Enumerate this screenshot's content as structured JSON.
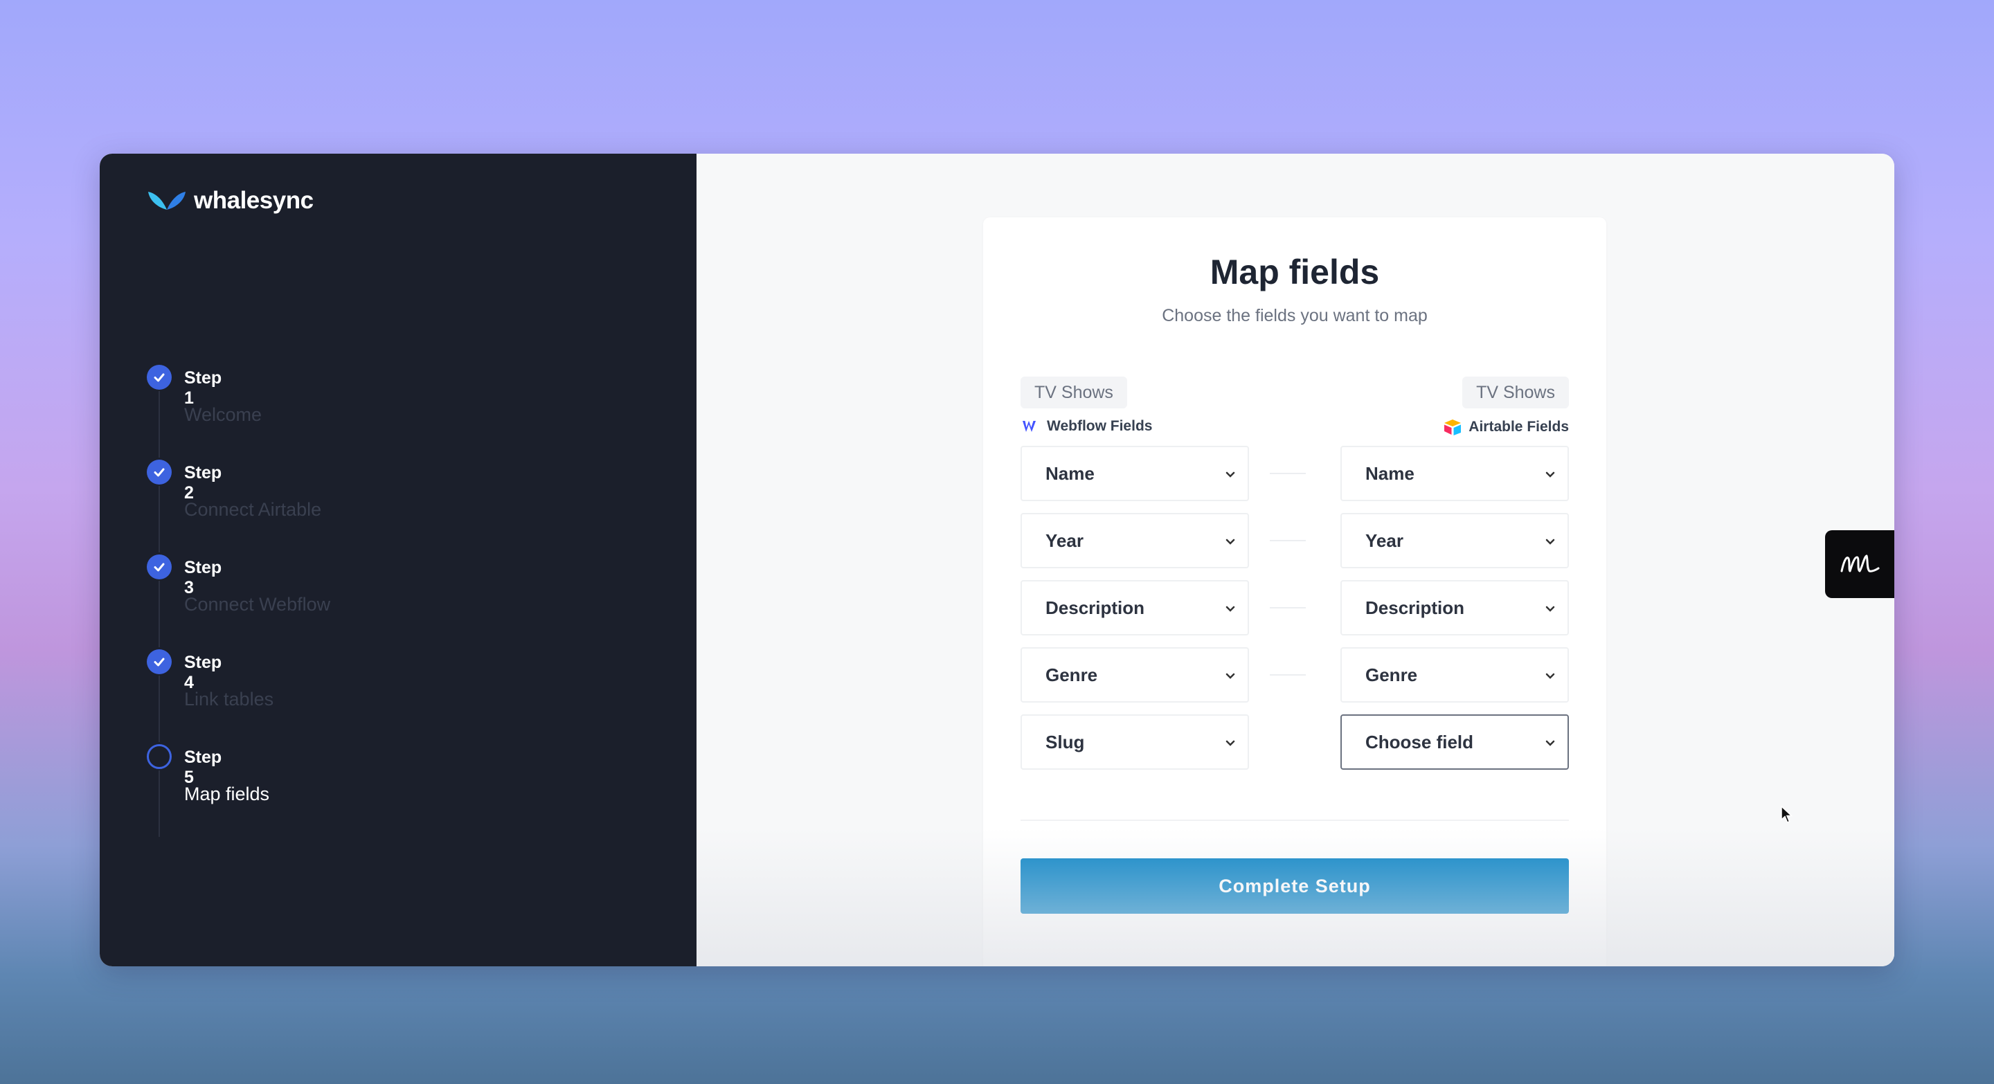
{
  "app": {
    "logo_text": "whalesync",
    "accent_color": "#3d63e0",
    "button_color": "#0a84c6"
  },
  "steps": [
    {
      "title": "Step 1",
      "subtitle": "Welcome",
      "status": "complete"
    },
    {
      "title": "Step 2",
      "subtitle": "Connect Airtable",
      "status": "complete"
    },
    {
      "title": "Step 3",
      "subtitle": "Connect Webflow",
      "status": "complete"
    },
    {
      "title": "Step 4",
      "subtitle": "Link tables",
      "status": "complete"
    },
    {
      "title": "Step 5",
      "subtitle": "Map fields",
      "status": "current"
    }
  ],
  "card": {
    "title": "Map fields",
    "subtitle": "Choose the fields you want to map",
    "left_table": "TV Shows",
    "right_table": "TV Shows",
    "left_label": "Webflow Fields",
    "right_label": "Airtable Fields",
    "left_fields": [
      "Name",
      "Year",
      "Description",
      "Genre",
      "Slug"
    ],
    "right_fields": [
      "Name",
      "Year",
      "Description",
      "Genre",
      "Choose field"
    ],
    "button_label": "Complete Setup"
  },
  "icons": {
    "logo": "whale-tail-icon",
    "step_complete": "check-circle-icon",
    "step_current": "circle-outline-icon",
    "webflow": "webflow-logo-icon",
    "airtable": "airtable-logo-icon",
    "side_badge": "signature-logo-icon"
  }
}
